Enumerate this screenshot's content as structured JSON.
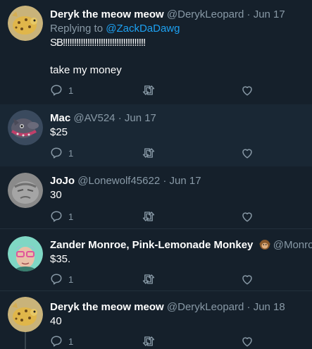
{
  "tweets": [
    {
      "name": "Deryk the meow meow",
      "handle": "@DerykLeopard",
      "separator": "·",
      "date": "Jun 17",
      "replying_prefix": "Replying to",
      "replying_to": "@ZackDaDawg",
      "line1": "SB!!!!!!!!!!!!!!!!!!!!!!!!!!!!!!!!!!!!!",
      "line2": "take my money",
      "reply_count": "1",
      "avatar": "leopard-avatar"
    },
    {
      "name": "Mac",
      "handle": "@AV524",
      "separator": "·",
      "date": "Jun 17",
      "text": "$25",
      "reply_count": "1",
      "avatar": "wolf-avatar"
    },
    {
      "name": "JoJo",
      "handle": "@Lonewolf45622",
      "separator": "·",
      "date": "Jun 17",
      "text": "30",
      "reply_count": "1",
      "avatar": "grey-wolf-avatar"
    },
    {
      "name": "Zander Monroe, Pink-Lemonade Monkey",
      "emoji": "monkey-emoji",
      "handle": "@Monroe",
      "text": "$35.",
      "reply_count": "1",
      "avatar": "cartoon-avatar"
    },
    {
      "name": "Deryk the meow meow",
      "handle": "@DerykLeopard",
      "separator": "·",
      "date": "Jun 18",
      "text": "40",
      "reply_count": "1",
      "avatar": "leopard-avatar"
    }
  ],
  "colors": {
    "background": "#15202b",
    "alt_background": "#192734",
    "muted": "#8899a6",
    "link": "#1da1f2"
  }
}
